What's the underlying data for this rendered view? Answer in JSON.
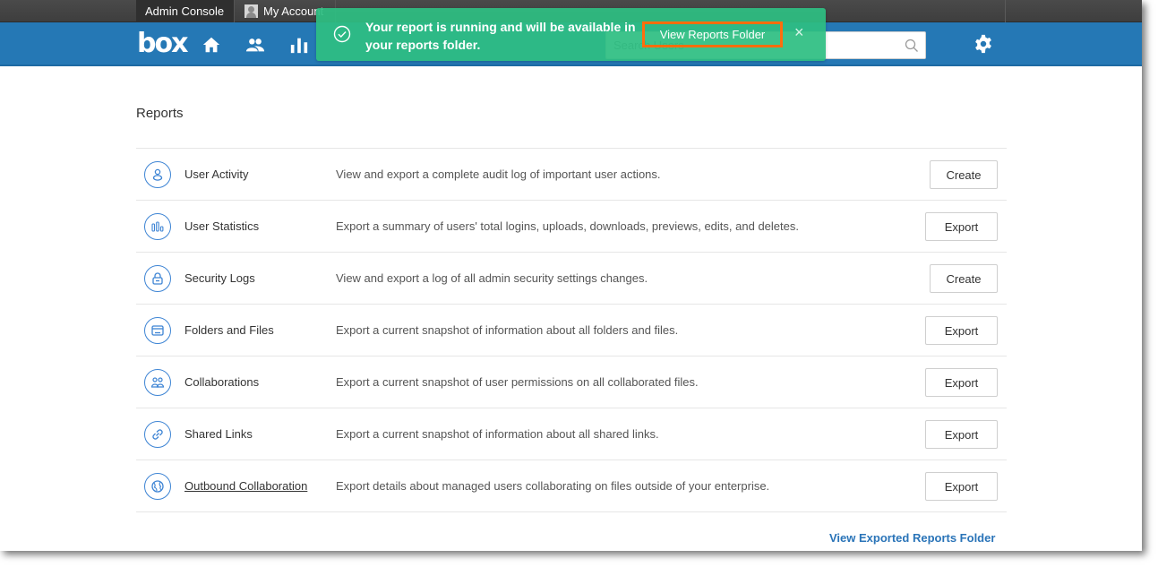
{
  "tabs": {
    "admin_console": "Admin Console",
    "my_account": "My Account"
  },
  "nav": {
    "logo": "box",
    "icons": [
      "home-icon",
      "users-icon",
      "reports-bar-chart-icon",
      "settings-gear-icon"
    ],
    "search_placeholder": "Search Users"
  },
  "toast": {
    "message": "Your report is running and will be available in your reports folder.",
    "button": "View Reports Folder",
    "close": "×",
    "highlight_color": "#ff6d0d",
    "background_color": "#2ebe82"
  },
  "page": {
    "title": "Reports",
    "footer_link": "View Exported Reports Folder"
  },
  "reports": [
    {
      "name": "User Activity",
      "icon": "user-icon",
      "description": "View and export a complete audit log of important user actions.",
      "action": "Create"
    },
    {
      "name": "User Statistics",
      "icon": "statistics-icon",
      "description": "Export a summary of users' total logins, uploads, downloads, previews, edits, and deletes.",
      "action": "Export"
    },
    {
      "name": "Security Logs",
      "icon": "lock-icon",
      "description": "View and export a log of all admin security settings changes.",
      "action": "Create"
    },
    {
      "name": "Folders and Files",
      "icon": "folder-icon",
      "description": "Export a current snapshot of information about all folders and files.",
      "action": "Export"
    },
    {
      "name": "Collaborations",
      "icon": "collaborators-icon",
      "description": "Export a current snapshot of user permissions on all collaborated files.",
      "action": "Export"
    },
    {
      "name": "Shared Links",
      "icon": "link-icon",
      "description": "Export a current snapshot of information about all shared links.",
      "action": "Export"
    },
    {
      "name": "Outbound Collaboration",
      "icon": "globe-icon",
      "description": "Export details about managed users collaborating on files outside of your enterprise.",
      "action": "Export"
    }
  ]
}
